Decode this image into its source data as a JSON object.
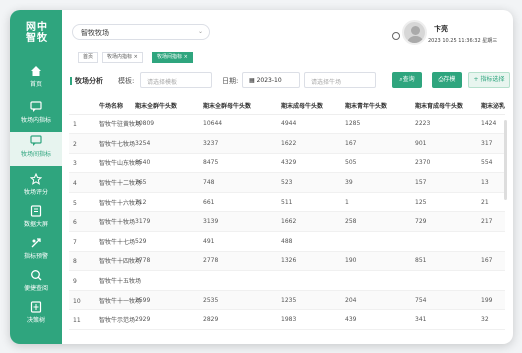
{
  "app": {
    "logo_line1": "网中",
    "logo_line2": "智牧"
  },
  "sidebar": {
    "items": [
      {
        "label": "首页",
        "icon": "home-icon"
      },
      {
        "label": "牧场内指标",
        "icon": "chat-icon"
      },
      {
        "label": "牧场间指标",
        "icon": "chat-icon",
        "active": true
      },
      {
        "label": "牧场评分",
        "icon": "star-icon"
      },
      {
        "label": "数据大屏",
        "icon": "screen-icon"
      },
      {
        "label": "指标预警",
        "icon": "alert-icon"
      },
      {
        "label": "便捷查阅",
        "icon": "search-icon"
      },
      {
        "label": "决策树",
        "icon": "tree-icon"
      }
    ]
  },
  "header": {
    "farm_select": "智牧牧场",
    "user_name": "卞亮",
    "datetime": "2023 10.25 11:36:32 星期三"
  },
  "tabs": [
    {
      "label": "首页",
      "closable": false
    },
    {
      "label": "牧场内指标",
      "closable": true
    },
    {
      "label": "牧场间指标",
      "closable": true,
      "active": true
    }
  ],
  "filter": {
    "title": "牧场分析",
    "template_label": "模板:",
    "template_placeholder": "请选择模板",
    "date_label": "日期:",
    "date_value": "2023-10",
    "indicator_placeholder": "请选择牛场",
    "query_button": "查询",
    "save_button": "存模",
    "add_button": "+ 指标选择"
  },
  "table": {
    "headers": [
      "牛场名称",
      "期末全群牛头数",
      "期末全群母牛头数",
      "期末成母牛头数",
      "期末青年牛头数",
      "期末育成母牛头数",
      "期末泌乳母牛头"
    ],
    "rows": [
      [
        "智牧牛驻黄牧场",
        "10809",
        "10644",
        "4944",
        "1285",
        "2223",
        "1424"
      ],
      [
        "智牧牛七牧场",
        "3254",
        "3237",
        "1622",
        "167",
        "901",
        "317"
      ],
      [
        "智牧牛山东牧场",
        "8540",
        "8475",
        "4329",
        "505",
        "2370",
        "554"
      ],
      [
        "智牧牛十二牧场",
        "765",
        "748",
        "523",
        "39",
        "157",
        "13"
      ],
      [
        "智牧牛十六牧场",
        "712",
        "661",
        "511",
        "1",
        "125",
        "21"
      ],
      [
        "智牧牛十牧场",
        "3179",
        "3139",
        "1662",
        "258",
        "729",
        "217"
      ],
      [
        "智牧牛十七场",
        "529",
        "491",
        "488",
        "",
        "",
        ""
      ],
      [
        "智牧牛十四牧场",
        "2778",
        "2778",
        "1326",
        "190",
        "851",
        "167"
      ],
      [
        "智牧牛十五牧场",
        "",
        "",
        "",
        "",
        "",
        ""
      ],
      [
        "智牧牛十一牧场",
        "2599",
        "2535",
        "1235",
        "204",
        "754",
        "199"
      ],
      [
        "智牧牛示范场",
        "2929",
        "2829",
        "1983",
        "439",
        "341",
        "32"
      ]
    ]
  },
  "colors": {
    "brand": "#2fa57e"
  }
}
